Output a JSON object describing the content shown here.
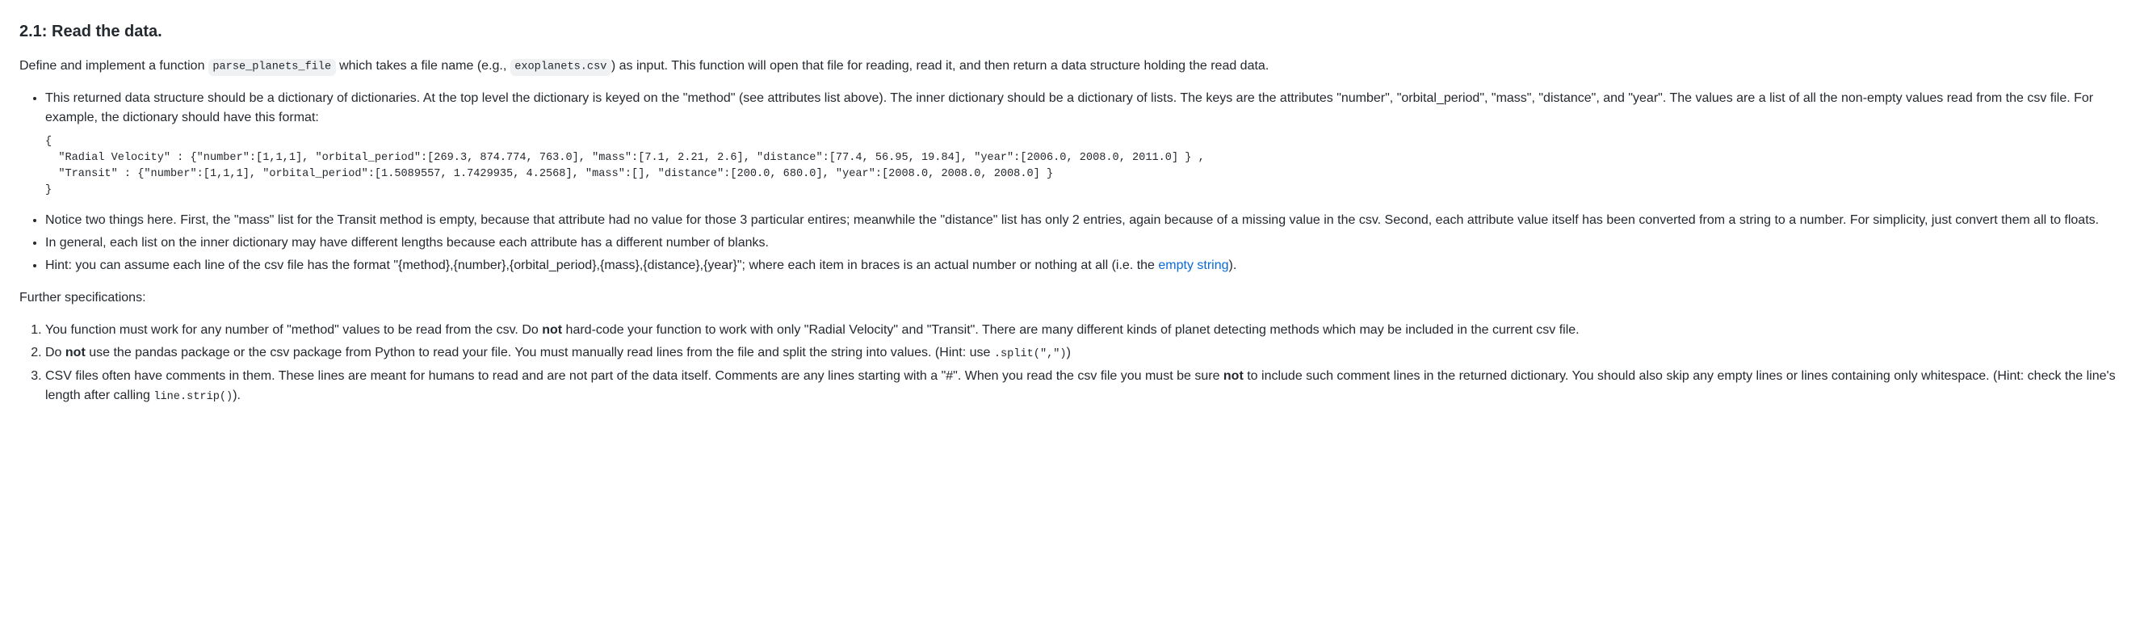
{
  "heading": "2.1: Read the data.",
  "intro": {
    "t1": "Define and implement a function ",
    "code1": "parse_planets_file",
    "t2": " which takes a file name (e.g., ",
    "code2": "exoplanets.csv",
    "t3": ") as input. This function will open that file for reading, read it, and then return a data structure holding the read data."
  },
  "bullets": {
    "b1": "This returned data structure should be a dictionary of dictionaries. At the top level the dictionary is keyed on the \"method\" (see attributes list above). The inner dictionary should be a dictionary of lists. The keys are the attributes \"number\", \"orbital_period\", \"mass\", \"distance\", and \"year\". The values are a list of all the non-empty values read from the csv file. For example, the dictionary should have this format:",
    "codeblock": "{\n  \"Radial Velocity\" : {\"number\":[1,1,1], \"orbital_period\":[269.3, 874.774, 763.0], \"mass\":[7.1, 2.21, 2.6], \"distance\":[77.4, 56.95, 19.84], \"year\":[2006.0, 2008.0, 2011.0] } ,\n  \"Transit\" : {\"number\":[1,1,1], \"orbital_period\":[1.5089557, 1.7429935, 4.2568], \"mass\":[], \"distance\":[200.0, 680.0], \"year\":[2008.0, 2008.0, 2008.0] }\n}",
    "b2": "Notice two things here. First, the \"mass\" list for the Transit method is empty, because that attribute had no value for those 3 particular entires; meanwhile the \"distance\" list has only 2 entries, again because of a missing value in the csv. Second, each attribute value itself has been converted from a string to a number. For simplicity, just convert them all to floats.",
    "b3": "In general, each list on the inner dictionary may have different lengths because each attribute has a different number of blanks.",
    "b4": {
      "t1": "Hint: you can assume each line of the csv file has the format \"{method},{number},{orbital_period},{mass},{distance},{year}\"; where each item in braces is an actual number or nothing at all (i.e. the ",
      "link": "empty string",
      "t2": ")."
    }
  },
  "further_label": "Further specifications:",
  "spec": {
    "s1": {
      "t1": "You function must work for any number of \"method\" values to be read from the csv. Do ",
      "bold": "not",
      "t2": " hard-code your function to work with only \"Radial Velocity\" and \"Transit\". There are many different kinds of planet detecting methods which may be included in the current csv file."
    },
    "s2": {
      "t1": "Do ",
      "bold": "not",
      "t2": " use the pandas package or the csv package from Python to read your file. You must manually read lines from the file and split the string into values. (Hint: use ",
      "code": ".split(\",\")",
      "t3": ")"
    },
    "s3": {
      "t1": "CSV files often have comments in them. These lines are meant for humans to read and are not part of the data itself. Comments are any lines starting with a \"#\". When you read the csv file you must be sure ",
      "bold": "not",
      "t2": " to include such comment lines in the returned dictionary. You should also skip any empty lines or lines containing only whitespace. (Hint: check the line's length after calling ",
      "code": "line.strip()",
      "t3": ")."
    }
  }
}
